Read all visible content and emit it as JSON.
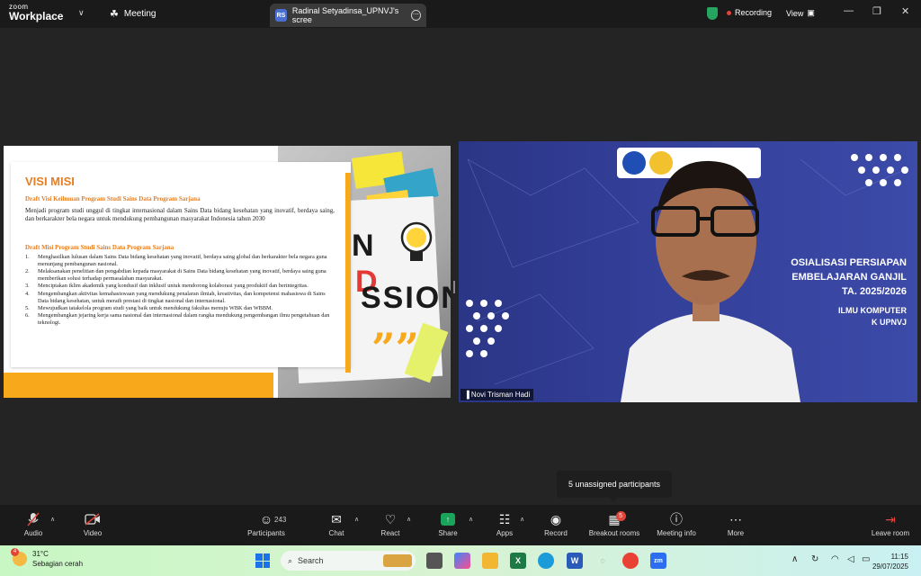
{
  "app": {
    "logo_line1": "zoom",
    "logo_line2": "Workplace",
    "meeting_label": "Meeting",
    "tab_badge": "RS",
    "tab_title": "Radinal Setyadinsa_UPNVJ's scree",
    "recording_label": "Recording",
    "view_label": "View"
  },
  "slide": {
    "title": "VISI MISI",
    "visi_heading": "Draft Visi Keilmuan Program Studi Sains Data Program Sarjana",
    "visi_body": "Menjadi program studi unggul di tingkat internasional dalam Sains Data bidang kesehatan yang inovatif, berdaya saing, dan berkarakter bela negara untuk mendukung pembangunan masyarakat Indonesia tahun 2030",
    "misi_heading": "Draft Misi Program Studi Sains Data Program Sarjana",
    "misi_items": [
      {
        "n": "1.",
        "t": "Menghasilkan lulusan dalam Sains Data bidang kesehatan yang inovatif, berdaya saing global dan berkarakter bela negara guna menunjang pembangunan nasional."
      },
      {
        "n": "2.",
        "t": "Melaksanakan penelitian dan pengabdian kepada masyarakat di Sains Data bidang kesehatan yang inovatif, berdaya saing guna memberikan solusi terhadap permasalahan masyarakat."
      },
      {
        "n": "3.",
        "t": "Menciptakan iklim akademik yang kondusif dan inklusif untuk mendorong kolaborasi yang produktif dan berintegritas."
      },
      {
        "n": "4.",
        "t": "Mengembangkan aktivitas kemahasiswaan yang mendukung penalaran ilmiah, kreativitas, dan kompetensi mahasiswa di Sains Data bidang kesehatan, untuk meraih prestasi di tingkat nasional dan internasional."
      },
      {
        "n": "5.",
        "t": "Mewujudkan tatakelola program studi yang baik untuk mendukung fakultas menuju WBK dan WBBM."
      },
      {
        "n": "6.",
        "t": "Mengembangkan jejaring kerja sama nasional dan internasional dalam rangka mendukung pengembangan ilmu pengetahuan dan teknologi."
      }
    ],
    "photo_word1": "N",
    "photo_word2": "D",
    "photo_word3": "SSION"
  },
  "video": {
    "line1": "OSIALISASI PERSIAPAN",
    "line2": "EMBELAJARAN GANJIL",
    "line3": "TA. 2025/2026",
    "line4": "ILMU KOMPUTER",
    "line5": "K UPNVJ",
    "participant_name": "Novi Trisman Hadi"
  },
  "tooltip": "5 unassigned participants",
  "toolbar": {
    "audio": "Audio",
    "video": "Video",
    "participants": "Participants",
    "participants_count": "243",
    "chat": "Chat",
    "react": "React",
    "share": "Share",
    "apps": "Apps",
    "record": "Record",
    "breakout": "Breakout rooms",
    "breakout_badge": "5",
    "meeting_info": "Meeting info",
    "more": "More",
    "leave": "Leave room"
  },
  "taskbar": {
    "weather_badge": "4",
    "temp": "31°C",
    "condition": "Sebagian cerah",
    "search_label": "Search",
    "time": "11:15",
    "date": "29/07/2025"
  }
}
